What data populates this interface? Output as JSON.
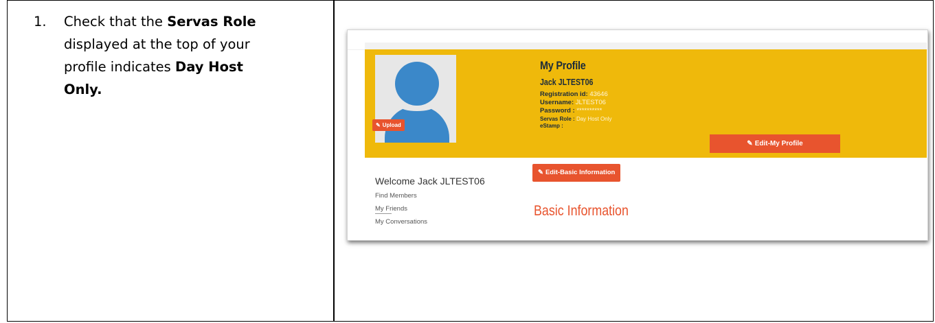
{
  "instruction": {
    "number": "1.",
    "line1_pre": "Check that the ",
    "line1_bold": "Servas Role",
    "line2": "displayed at the top of your",
    "line3_pre": "profile indicates ",
    "line3_bold": "Day Host",
    "line4_bold": "Only."
  },
  "profile": {
    "title": "My Profile",
    "name": "Jack JLTEST06",
    "registration_label": "Registration id:",
    "registration_value": "43646",
    "username_label": "Username:",
    "username_value": "JLTEST06",
    "password_label": "Password :",
    "password_value": "**********",
    "role_label": "Servas Role :",
    "role_value": "Day Host Only",
    "estamp_label": "eStamp :",
    "upload_label": "Upload",
    "edit_profile_label": "Edit-My Profile"
  },
  "sidebar": {
    "welcome": "Welcome Jack JLTEST06",
    "links": [
      "Find Members",
      "My Friends",
      "My Conversations"
    ]
  },
  "main": {
    "edit_basic_label": "Edit-Basic Information",
    "section_title": "Basic Information"
  },
  "colors": {
    "banner": "#efb90b",
    "accent": "#e8542e",
    "avatar": "#3b88c9"
  }
}
